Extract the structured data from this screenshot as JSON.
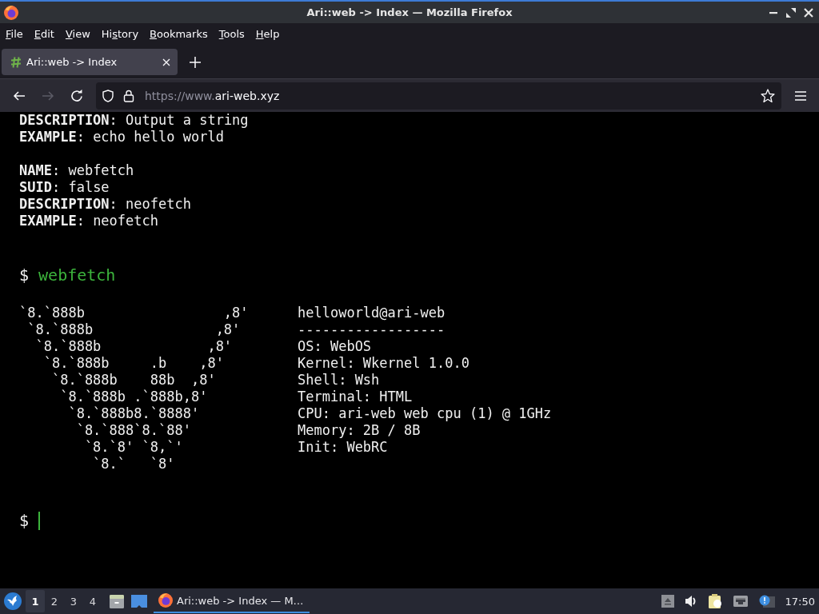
{
  "window": {
    "title": "Ari::web -> Index — Mozilla Firefox"
  },
  "menu_bar": [
    {
      "access_key": "F",
      "text_after": "ile"
    },
    {
      "access_key": "E",
      "text_after": "dit"
    },
    {
      "access_key": "V",
      "text_after": "iew"
    },
    {
      "text_before": "Hi",
      "access_key": "s",
      "text_after": "tory"
    },
    {
      "access_key": "B",
      "text_after": "ookmarks"
    },
    {
      "access_key": "T",
      "text_after": "ools"
    },
    {
      "access_key": "H",
      "text_after": "elp"
    }
  ],
  "tabs": [
    {
      "title": "Ari::web -> Index",
      "selected": true
    }
  ],
  "nav_buttons": [
    {
      "kind": "back",
      "disabled": false
    },
    {
      "kind": "forward",
      "disabled": true
    },
    {
      "kind": "reload",
      "disabled": false
    }
  ],
  "address_bar": {
    "url_scheme": "https://www.",
    "url_host": "ari-web.xyz"
  },
  "terminal": {
    "help_blocks": [
      [
        "**DESCRIPTION**: Output a string",
        "**EXAMPLE**: echo hello world"
      ],
      [
        "**NAME**: webfetch",
        "**SUID**: false",
        "**DESCRIPTION**: neofetch",
        "**EXAMPLE**: neofetch"
      ]
    ],
    "command": {
      "prompt": "$",
      "text": "webfetch"
    },
    "fetch": {
      "art": [
        "`8.`888b                 ,8'",
        " `8.`888b               ,8'",
        "  `8.`888b             ,8'",
        "   `8.`888b     .b    ,8'",
        "    `8.`888b    88b  ,8'",
        "     `8.`888b .`888b,8'",
        "      `8.`888b8.`8888'",
        "       `8.`888`8.`88'",
        "        `8.`8' `8,`'",
        "         `8.`   `8'"
      ],
      "info": [
        "helloworld@ari-web",
        "------------------",
        "OS: WebOS",
        "Kernel: Wkernel 1.0.0",
        "Shell: Wsh",
        "Terminal: HTML",
        "CPU: ari-web web cpu (1) @ 1GHz",
        "Memory: 2B / 8B",
        "Init: WebRC"
      ]
    },
    "input": {
      "prompt": "$"
    }
  },
  "taskbar": {
    "workspaces": [
      {
        "label": "1",
        "selected": true
      },
      {
        "label": "2",
        "selected": false
      },
      {
        "label": "3",
        "selected": false
      },
      {
        "label": "4",
        "selected": false
      }
    ],
    "tasks": [
      {
        "title": "Ari::web -> Index — M…",
        "selected": true
      }
    ],
    "clock": "17:50"
  }
}
